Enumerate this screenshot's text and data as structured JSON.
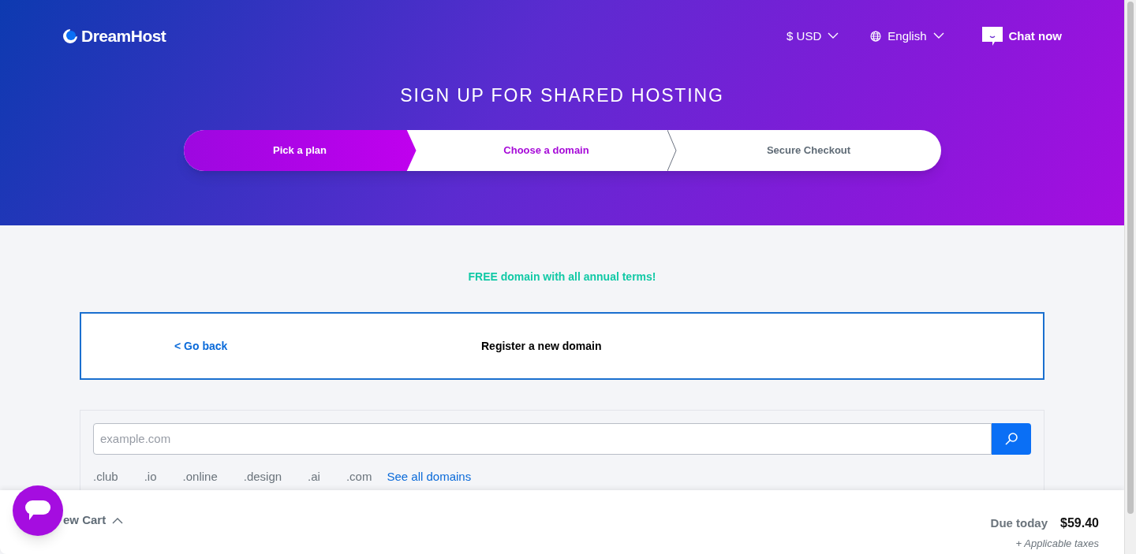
{
  "header": {
    "logo": "DreamHost",
    "currency": "$ USD",
    "language": "English",
    "chat": "Chat now",
    "title": "SIGN UP FOR SHARED HOSTING"
  },
  "steps": [
    {
      "label": "Pick a plan",
      "completed": true,
      "selected": false
    },
    {
      "label": "Choose a domain",
      "completed": false,
      "selected": true
    },
    {
      "label": "Secure Checkout",
      "completed": false,
      "selected": false
    }
  ],
  "promo": "FREE domain with all annual terms!",
  "domain_panel": {
    "back": "< Go back",
    "title": "Register a new domain"
  },
  "search": {
    "placeholder": "example.com"
  },
  "tlds": [
    ".club",
    ".io",
    ".online",
    ".design",
    ".ai",
    ".com"
  ],
  "see_all": "See all domains",
  "cart": {
    "label": "ew Cart",
    "due_label": "Due today",
    "due": "$59.40",
    "taxes": "+ Applicable taxes"
  }
}
